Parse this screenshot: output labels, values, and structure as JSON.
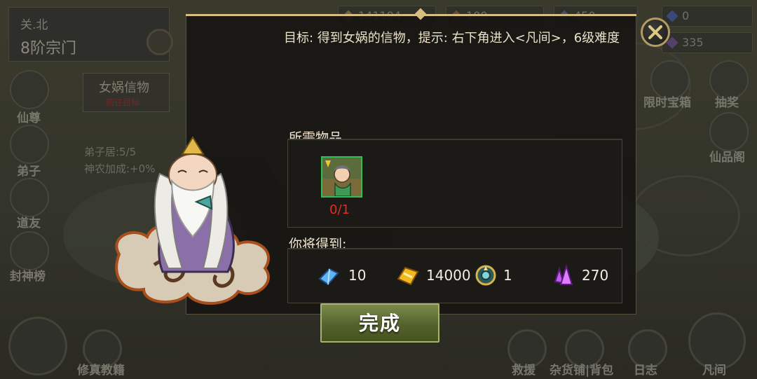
{
  "stage": {
    "region": "关.北",
    "sect_rank": "8阶宗门"
  },
  "resources": [
    "141194",
    "100",
    "450",
    "0",
    "335"
  ],
  "left_menu": [
    "仙尊",
    "弟子",
    "道友",
    "封神榜"
  ],
  "right_menu": [
    "限时宝箱",
    "抽奖",
    "仙品阁"
  ],
  "quest_pill": {
    "title": "女娲信物",
    "tag": "前往目标"
  },
  "disciple_info": {
    "count": "弟子居:5/5",
    "bonus": "神农加成:+0%"
  },
  "bottom_menu": [
    "修真教籍",
    "救援",
    "杂货铺|背包",
    "日志",
    "凡间"
  ],
  "dialog": {
    "goal": "目标: 得到女娲的信物，提示: 右下角进入<凡间>，6级难度",
    "required_title": "所需物品",
    "required_items": [
      {
        "icon": "nuwa-token-portrait-icon",
        "count": "0/1"
      }
    ],
    "rewards_title": "你将得到:",
    "rewards": [
      {
        "icon": "blue-crystal-icon",
        "amount": "10"
      },
      {
        "icon": "gold-ingot-icon",
        "amount": "14000"
      },
      {
        "icon": "compass-orb-icon",
        "amount": "1"
      },
      {
        "icon": "purple-crystal-icon",
        "amount": "270"
      }
    ],
    "complete_label": "完成"
  },
  "colors": {
    "accent_gold": "#b49a64",
    "count_red": "#e32c24",
    "button_green": "#5a6a2f"
  }
}
